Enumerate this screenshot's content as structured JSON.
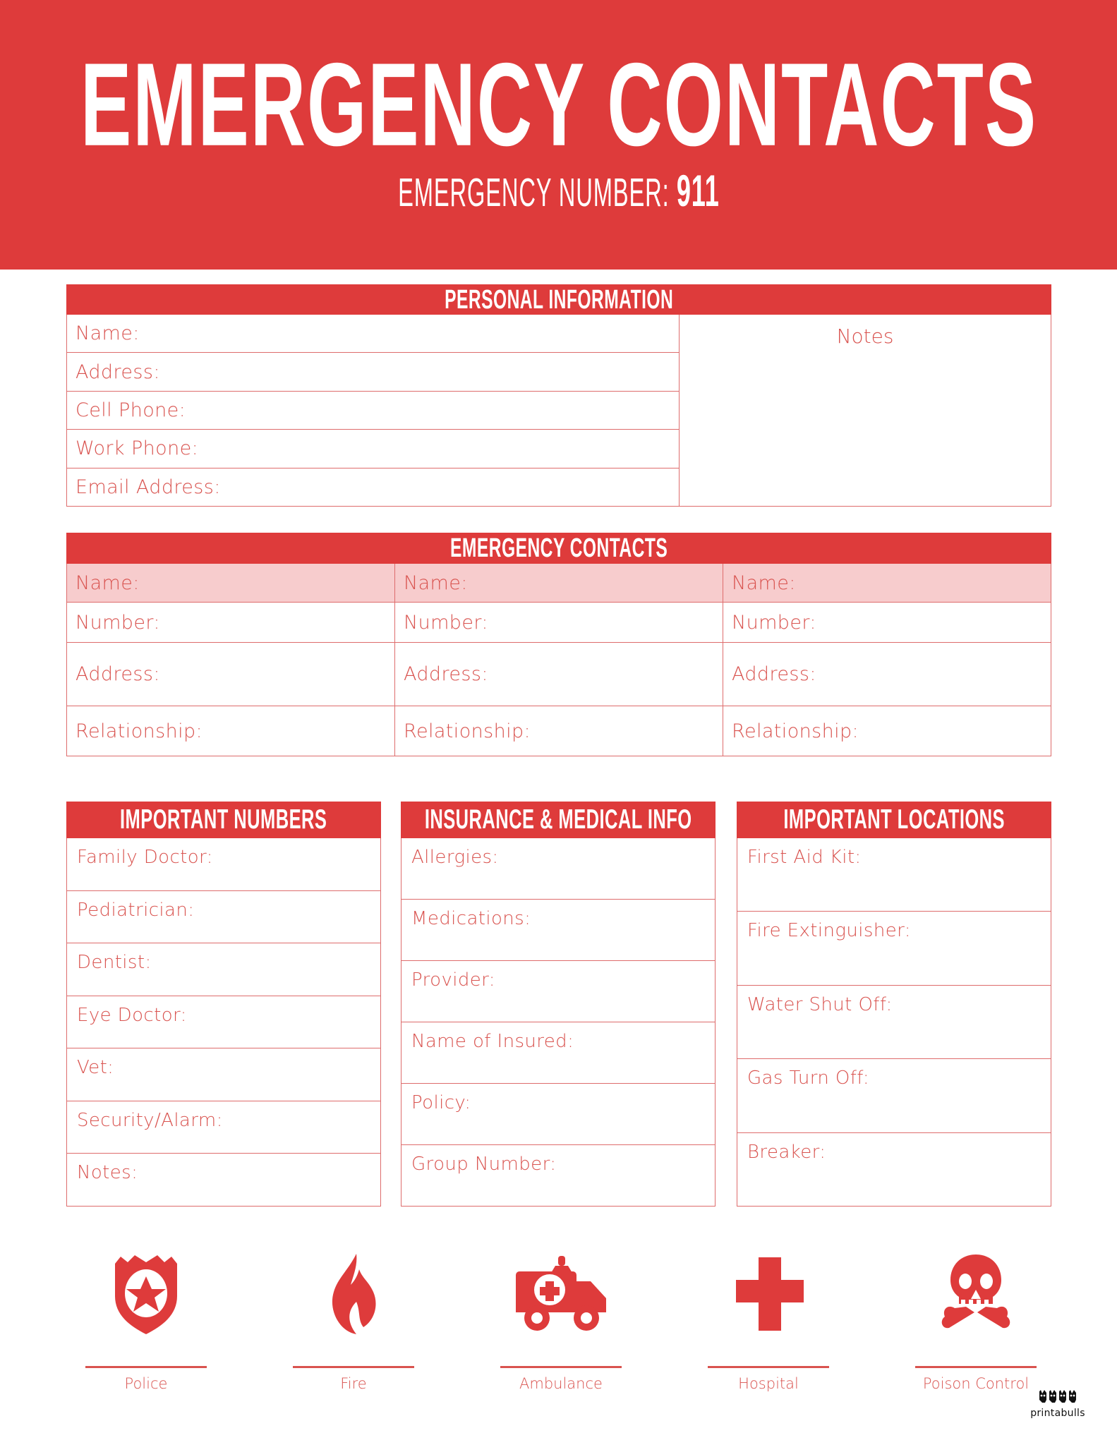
{
  "theme": {
    "red": "#DE3B3B",
    "border_red": "#DE6C6C",
    "label_red": "#D9534F",
    "pink_row": "#F7CCCD",
    "white": "#FFFFFF"
  },
  "header": {
    "title": "EMERGENCY CONTACTS",
    "subtitle_label": "EMERGENCY NUMBER:",
    "subtitle_number": "911"
  },
  "personal_info": {
    "heading": "PERSONAL INFORMATION",
    "fields": [
      "Name:",
      "Address:",
      "Cell Phone:",
      "Work Phone:",
      "Email Address:"
    ],
    "notes_title": "Notes"
  },
  "emergency_contacts": {
    "heading": "EMERGENCY CONTACTS",
    "row_labels": [
      "Name:",
      "Number:",
      "Address:",
      "Relationship:"
    ],
    "columns": [
      {
        "name": "Name:",
        "number": "Number:",
        "address": "Address:",
        "relationship": "Relationship:"
      },
      {
        "name": "Name:",
        "number": "Number:",
        "address": "Address:",
        "relationship": "Relationship:"
      },
      {
        "name": "Name:",
        "number": "Number:",
        "address": "Address:",
        "relationship": "Relationship:"
      }
    ]
  },
  "important_numbers": {
    "heading": "IMPORTANT NUMBERS",
    "fields": [
      "Family Doctor:",
      "Pediatrician:",
      "Dentist:",
      "Eye Doctor:",
      "Vet:",
      "Security/Alarm:",
      "Notes:"
    ]
  },
  "insurance_medical": {
    "heading": "INSURANCE & MEDICAL INFO",
    "fields": [
      "Allergies:",
      "Medications:",
      "Provider:",
      "Name of Insured:",
      "Policy:",
      "Group Number:"
    ]
  },
  "important_locations": {
    "heading": "IMPORTANT LOCATIONS",
    "fields": [
      "First Aid Kit:",
      "Fire Extinguisher:",
      "Water Shut Off:",
      "Gas Turn Off:",
      "Breaker:"
    ]
  },
  "icon_strip": [
    {
      "icon": "police-badge-icon",
      "label": "Police"
    },
    {
      "icon": "fire-flame-icon",
      "label": "Fire"
    },
    {
      "icon": "ambulance-icon",
      "label": "Ambulance"
    },
    {
      "icon": "medical-cross-icon",
      "label": "Hospital"
    },
    {
      "icon": "skull-crossbones-icon",
      "label": "Poison Control"
    }
  ],
  "watermark": {
    "icon": "printabulls-bulldogs-logo",
    "text": "printabulls"
  }
}
